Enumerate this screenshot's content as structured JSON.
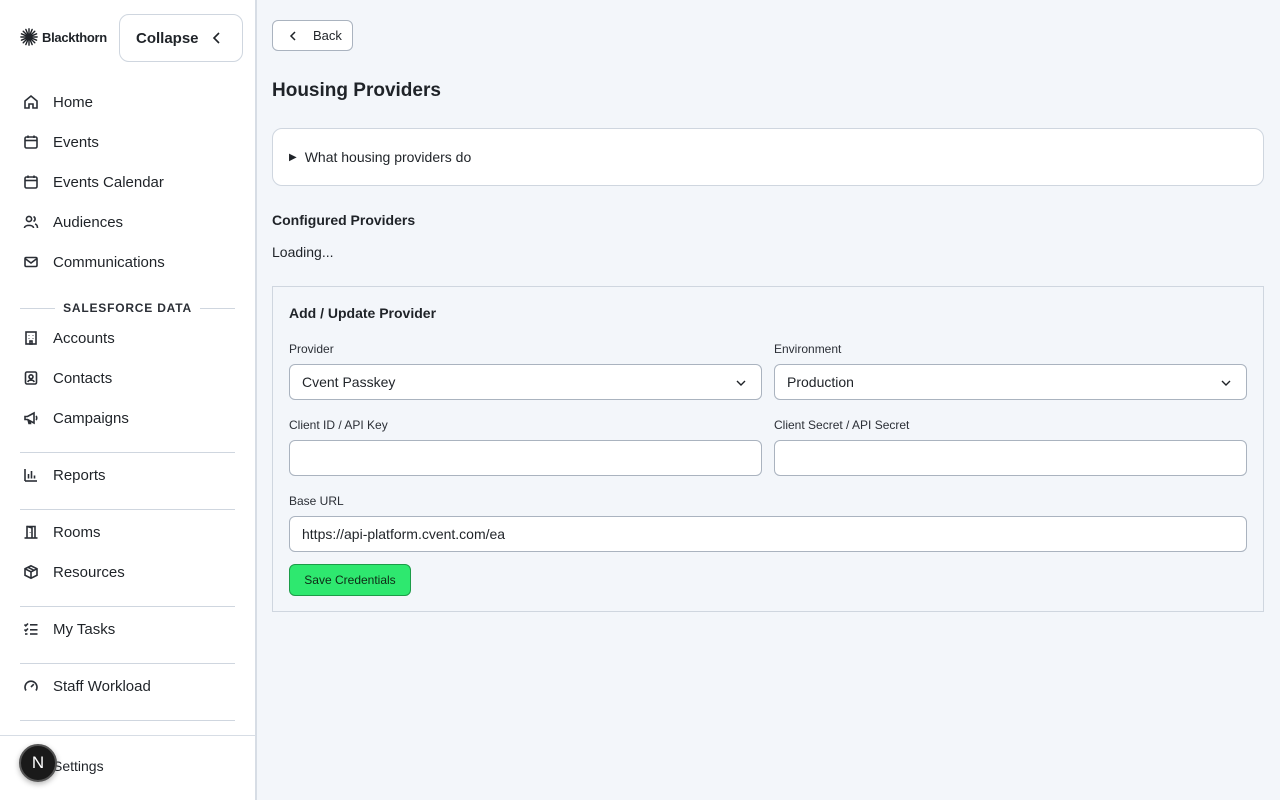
{
  "sidebar": {
    "brand": "Blackthorn",
    "collapse_label": "Collapse",
    "items": [
      {
        "label": "Home",
        "icon": "home-icon"
      },
      {
        "label": "Events",
        "icon": "calendar-icon"
      },
      {
        "label": "Events Calendar",
        "icon": "calendar-icon"
      },
      {
        "label": "Audiences",
        "icon": "users-icon"
      },
      {
        "label": "Communications",
        "icon": "mail-icon"
      }
    ],
    "section_title": "SALESFORCE DATA",
    "sf_items": [
      {
        "label": "Accounts",
        "icon": "building-icon"
      },
      {
        "label": "Contacts",
        "icon": "contact-icon"
      },
      {
        "label": "Campaigns",
        "icon": "megaphone-icon"
      }
    ],
    "reports_label": "Reports",
    "rooms_label": "Rooms",
    "resources_label": "Resources",
    "tasks_label": "My Tasks",
    "workload_label": "Staff Workload",
    "settings_label": "Settings",
    "avatar_letter": "N"
  },
  "main": {
    "back_label": "Back",
    "title": "Housing Providers",
    "details_summary": "What housing providers do",
    "configured_heading": "Configured Providers",
    "loading_text": "Loading...",
    "form": {
      "title": "Add / Update Provider",
      "provider_label": "Provider",
      "provider_value": "Cvent Passkey",
      "environment_label": "Environment",
      "environment_value": "Production",
      "client_id_label": "Client ID / API Key",
      "client_id_value": "",
      "client_secret_label": "Client Secret / API Secret",
      "client_secret_value": "",
      "base_url_label": "Base URL",
      "base_url_value": "https://api-platform.cvent.com/ea",
      "save_label": "Save Credentials"
    }
  },
  "colors": {
    "accent_green": "#2ee86f",
    "page_bg": "#f3f6fa"
  }
}
